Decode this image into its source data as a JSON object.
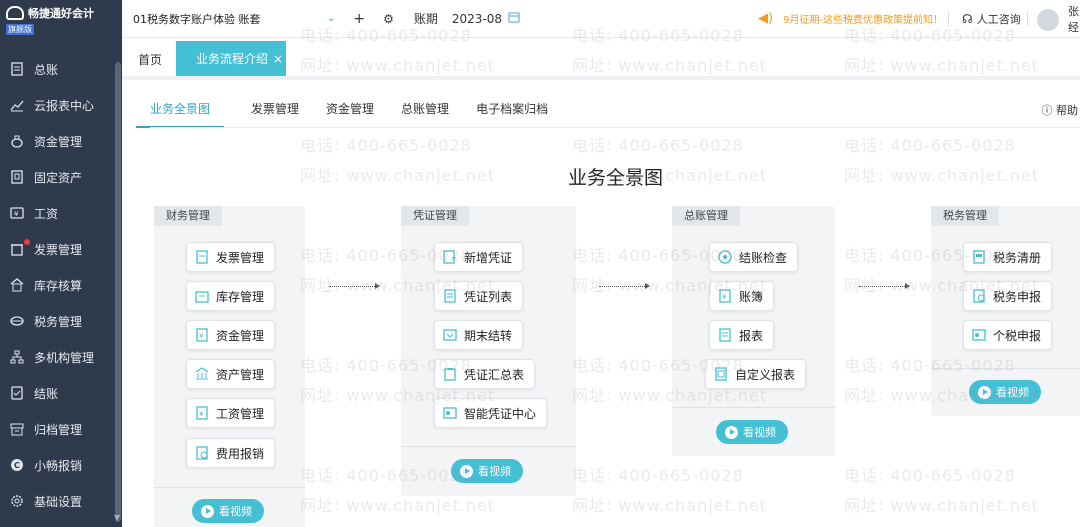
{
  "app": {
    "name": "畅捷通好会计",
    "edition": "旗舰版"
  },
  "sidebar": {
    "items": [
      {
        "label": "总账",
        "icon": "ledger-icon"
      },
      {
        "label": "云报表中心",
        "icon": "chart-icon"
      },
      {
        "label": "资金管理",
        "icon": "money-bag-icon"
      },
      {
        "label": "固定资产",
        "icon": "asset-icon"
      },
      {
        "label": "工资",
        "icon": "salary-icon"
      },
      {
        "label": "发票管理",
        "icon": "invoice-icon",
        "badge": true
      },
      {
        "label": "库存核算",
        "icon": "warehouse-icon"
      },
      {
        "label": "税务管理",
        "icon": "tax-icon"
      },
      {
        "label": "多机构管理",
        "icon": "org-icon"
      },
      {
        "label": "结账",
        "icon": "close-books-icon"
      },
      {
        "label": "归档管理",
        "icon": "archive-icon"
      },
      {
        "label": "小畅报销",
        "icon": "expense-icon"
      },
      {
        "label": "基础设置",
        "icon": "settings-icon"
      }
    ]
  },
  "header": {
    "account": "01税务数字账户体验 账套",
    "period_label": "账期",
    "period_value": "2023-08",
    "notice": "9月征期-这些税费优惠政策提前知！",
    "consult": "人工咨询",
    "username": "张经"
  },
  "tabs": {
    "home": "首页",
    "active": "业务流程介绍",
    "close": "×"
  },
  "subtabs": [
    "业务全景图",
    "发票管理",
    "资金管理",
    "总账管理",
    "电子档案归档"
  ],
  "help": "帮助",
  "page_title": "业务全景图",
  "cards": [
    {
      "title": "财务管理",
      "items": [
        "发票管理",
        "库存管理",
        "资金管理",
        "资产管理",
        "工资管理",
        "费用报销"
      ],
      "video": "看视频"
    },
    {
      "title": "凭证管理",
      "items": [
        "新增凭证",
        "凭证列表",
        "期末结转",
        "凭证汇总表",
        "智能凭证中心"
      ],
      "video": "看视频"
    },
    {
      "title": "总账管理",
      "items": [
        "结账检查",
        "账簿",
        "报表",
        "自定义报表"
      ],
      "video": "看视频"
    },
    {
      "title": "税务管理",
      "items": [
        "税务清册",
        "税务申报",
        "个税申报"
      ],
      "video": "看视频"
    }
  ],
  "watermarks": {
    "phone": "电话: 400-665-0028",
    "site": "网址: www.chanjet.net"
  },
  "colors": {
    "sidebar": "#2f3a4c",
    "accent": "#45bfd4",
    "notice": "#f29a21"
  }
}
